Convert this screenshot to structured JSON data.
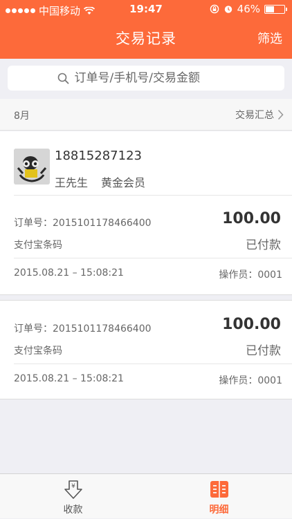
{
  "status_bar": {
    "carrier": "中国移动",
    "time": "19:47",
    "battery": "46%",
    "battery_level": 0.46
  },
  "nav": {
    "title": "交易记录",
    "filter_label": "筛选"
  },
  "search": {
    "placeholder": "订单号/手机号/交易金额"
  },
  "month_bar": {
    "month": "8月",
    "summary_label": "交易汇总"
  },
  "member": {
    "phone": "18815287123",
    "name": "王先生",
    "level": "黄金会员"
  },
  "orders": [
    {
      "order_no": "订单号：2015101178466400",
      "amount": "100.00",
      "pay_method": "支付宝条码",
      "status": "已付款",
      "time": "2015.08.21 – 15:08:21",
      "operator": "操作员：0001"
    },
    {
      "order_no": "订单号：2015101178466400",
      "amount": "100.00",
      "pay_method": "支付宝条码",
      "status": "已付款",
      "time": "2015.08.21 – 15:08:21",
      "operator": "操作员：0001"
    }
  ],
  "tabbar": {
    "collect_label": "收款",
    "detail_label": "明细",
    "active": "detail"
  },
  "colors": {
    "accent": "#fd6a3a",
    "background": "#efeff4"
  }
}
